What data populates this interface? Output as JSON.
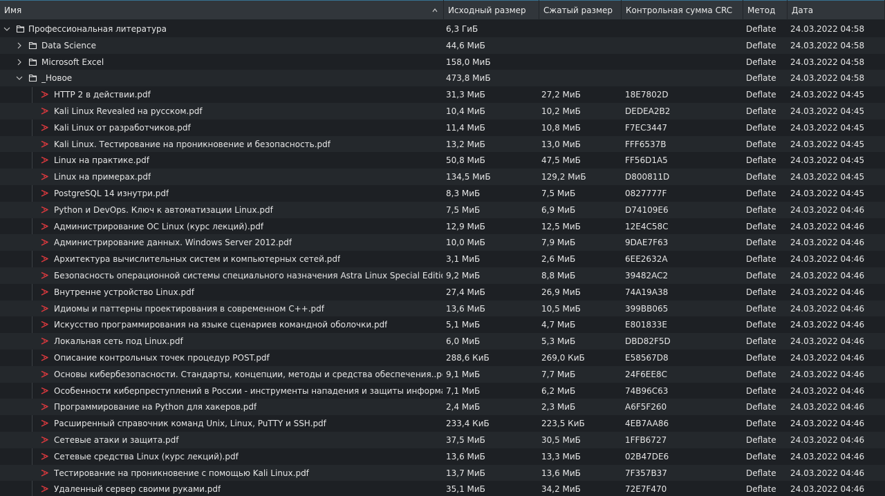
{
  "columns": [
    {
      "key": "name",
      "label": "Имя",
      "sorted": "ascending"
    },
    {
      "key": "orig",
      "label": "Исходный размер"
    },
    {
      "key": "comp",
      "label": "Сжатый размер"
    },
    {
      "key": "crc",
      "label": "Контрольная сумма CRC"
    },
    {
      "key": "method",
      "label": "Метод"
    },
    {
      "key": "date",
      "label": "Дата"
    }
  ],
  "rows": [
    {
      "type": "folder",
      "level": 0,
      "expanded": true,
      "name": "Профессиональная литература",
      "orig": "6,3 ГиБ",
      "comp": "",
      "crc": "",
      "method": "Deflate",
      "date": "24.03.2022 04:58"
    },
    {
      "type": "folder",
      "level": 1,
      "expanded": false,
      "name": "Data Science",
      "orig": "44,6 МиБ",
      "comp": "",
      "crc": "",
      "method": "Deflate",
      "date": "24.03.2022 04:58"
    },
    {
      "type": "folder",
      "level": 1,
      "expanded": false,
      "name": "Microsoft Excel",
      "orig": "158,0 МиБ",
      "comp": "",
      "crc": "",
      "method": "Deflate",
      "date": "24.03.2022 04:58"
    },
    {
      "type": "folder",
      "level": 1,
      "expanded": true,
      "name": "_Новое",
      "orig": "473,8 МиБ",
      "comp": "",
      "crc": "",
      "method": "Deflate",
      "date": "24.03.2022 04:58"
    },
    {
      "type": "pdf",
      "level": 2,
      "name": "HTTP 2 в действии.pdf",
      "orig": "31,3 МиБ",
      "comp": "27,2 МиБ",
      "crc": "18E7802D",
      "method": "Deflate",
      "date": "24.03.2022 04:45"
    },
    {
      "type": "pdf",
      "level": 2,
      "name": "Kali Linux Revealed на русском.pdf",
      "orig": "10,4 МиБ",
      "comp": "10,2 МиБ",
      "crc": "DEDEA2B2",
      "method": "Deflate",
      "date": "24.03.2022 04:45"
    },
    {
      "type": "pdf",
      "level": 2,
      "name": "Kali Linux от разработчиков.pdf",
      "orig": "11,4 МиБ",
      "comp": "10,8 МиБ",
      "crc": "F7EC3447",
      "method": "Deflate",
      "date": "24.03.2022 04:45"
    },
    {
      "type": "pdf",
      "level": 2,
      "name": "Kali Linux. Тестирование на проникновение и безопасность.pdf",
      "orig": "13,2 МиБ",
      "comp": "13,0 МиБ",
      "crc": "FFF6537B",
      "method": "Deflate",
      "date": "24.03.2022 04:45"
    },
    {
      "type": "pdf",
      "level": 2,
      "name": "Linux на практике.pdf",
      "orig": "50,8 МиБ",
      "comp": "47,5 МиБ",
      "crc": "FF56D1A5",
      "method": "Deflate",
      "date": "24.03.2022 04:45"
    },
    {
      "type": "pdf",
      "level": 2,
      "name": "Linux на примерах.pdf",
      "orig": "134,5 МиБ",
      "comp": "129,2 МиБ",
      "crc": "D800811D",
      "method": "Deflate",
      "date": "24.03.2022 04:45"
    },
    {
      "type": "pdf",
      "level": 2,
      "name": "PostgreSQL 14 изнутри.pdf",
      "orig": "8,3 МиБ",
      "comp": "7,5 МиБ",
      "crc": "0827777F",
      "method": "Deflate",
      "date": "24.03.2022 04:45"
    },
    {
      "type": "pdf",
      "level": 2,
      "name": "Python и DevOps. Ключ к автоматизации Linux.pdf",
      "orig": "7,5 МиБ",
      "comp": "6,9 МиБ",
      "crc": "D74109E6",
      "method": "Deflate",
      "date": "24.03.2022 04:46"
    },
    {
      "type": "pdf",
      "level": 2,
      "name": "Администрирование ОС Linux (курс лекций).pdf",
      "orig": "12,9 МиБ",
      "comp": "12,5 МиБ",
      "crc": "12E4C58C",
      "method": "Deflate",
      "date": "24.03.2022 04:46"
    },
    {
      "type": "pdf",
      "level": 2,
      "name": "Администрирование данных. Windows Server 2012.pdf",
      "orig": "10,0 МиБ",
      "comp": "7,9 МиБ",
      "crc": "9DAE7F63",
      "method": "Deflate",
      "date": "24.03.2022 04:46"
    },
    {
      "type": "pdf",
      "level": 2,
      "name": "Архитектура вычислительных систем и компьютерных сетей.pdf",
      "orig": "3,1 МиБ",
      "comp": "2,6 МиБ",
      "crc": "6EE2632A",
      "method": "Deflate",
      "date": "24.03.2022 04:46"
    },
    {
      "type": "pdf",
      "level": 2,
      "name": "Безопасность операционной системы специального назначения Astra Linux Special Edition.pdf",
      "orig": "9,2 МиБ",
      "comp": "8,8 МиБ",
      "crc": "39482AC2",
      "method": "Deflate",
      "date": "24.03.2022 04:46"
    },
    {
      "type": "pdf",
      "level": 2,
      "name": "Внутренне устройство Linux.pdf",
      "orig": "27,4 МиБ",
      "comp": "26,9 МиБ",
      "crc": "74A19A38",
      "method": "Deflate",
      "date": "24.03.2022 04:46"
    },
    {
      "type": "pdf",
      "level": 2,
      "name": "Идиомы и паттерны проектирования в современном С++.pdf",
      "orig": "13,6 МиБ",
      "comp": "10,5 МиБ",
      "crc": "399BB065",
      "method": "Deflate",
      "date": "24.03.2022 04:46"
    },
    {
      "type": "pdf",
      "level": 2,
      "name": "Искусство программирования на языке сценариев командной оболочки.pdf",
      "orig": "5,1 МиБ",
      "comp": "4,7 МиБ",
      "crc": "E801833E",
      "method": "Deflate",
      "date": "24.03.2022 04:46"
    },
    {
      "type": "pdf",
      "level": 2,
      "name": "Локальная сеть под Linux.pdf",
      "orig": "6,0 МиБ",
      "comp": "5,3 МиБ",
      "crc": "DBD82F5D",
      "method": "Deflate",
      "date": "24.03.2022 04:46"
    },
    {
      "type": "pdf",
      "level": 2,
      "name": "Описание контрольных точек процедур POST.pdf",
      "orig": "288,6 КиБ",
      "comp": "269,0 КиБ",
      "crc": "E58567D8",
      "method": "Deflate",
      "date": "24.03.2022 04:46"
    },
    {
      "type": "pdf",
      "level": 2,
      "name": "Основы кибербезопасности. Стандарты, концепции, методы и средства обеспечения..pdf",
      "orig": "9,1 МиБ",
      "comp": "7,7 МиБ",
      "crc": "24F6EE8C",
      "method": "Deflate",
      "date": "24.03.2022 04:46"
    },
    {
      "type": "pdf",
      "level": 2,
      "name": "Особенности киберпреступлений в России - инструменты нападения и защиты информации.pdf",
      "orig": "7,1 МиБ",
      "comp": "6,2 МиБ",
      "crc": "74B96C63",
      "method": "Deflate",
      "date": "24.03.2022 04:46"
    },
    {
      "type": "pdf",
      "level": 2,
      "name": "Программирование на Python для хакеров.pdf",
      "orig": "2,4 МиБ",
      "comp": "2,3 МиБ",
      "crc": "A6F5F260",
      "method": "Deflate",
      "date": "24.03.2022 04:46"
    },
    {
      "type": "pdf",
      "level": 2,
      "name": "Расширенный справочник команд Unix, Linux, PuTTY и SSH.pdf",
      "orig": "233,4 КиБ",
      "comp": "223,5 КиБ",
      "crc": "4EB7AA86",
      "method": "Deflate",
      "date": "24.03.2022 04:46"
    },
    {
      "type": "pdf",
      "level": 2,
      "name": "Сетевые атаки и защита.pdf",
      "orig": "37,5 МиБ",
      "comp": "30,5 МиБ",
      "crc": "1FFB6727",
      "method": "Deflate",
      "date": "24.03.2022 04:46"
    },
    {
      "type": "pdf",
      "level": 2,
      "name": "Сетевые средства Linux (курс лекций).pdf",
      "orig": "13,6 МиБ",
      "comp": "13,3 МиБ",
      "crc": "02B47DE6",
      "method": "Deflate",
      "date": "24.03.2022 04:46"
    },
    {
      "type": "pdf",
      "level": 2,
      "name": "Тестирование на проникновение с помощью Kali Linux.pdf",
      "orig": "13,7 МиБ",
      "comp": "13,6 МиБ",
      "crc": "7F357B37",
      "method": "Deflate",
      "date": "24.03.2022 04:46"
    },
    {
      "type": "pdf",
      "level": 2,
      "name": "Удаленный сервер своими руками.pdf",
      "orig": "35,1 МиБ",
      "comp": "34,2 МиБ",
      "crc": "72E7F470",
      "method": "Deflate",
      "date": "24.03.2022 04:46"
    }
  ],
  "colors": {
    "header_bg": "#31363b",
    "row_bg": "#1d2024",
    "row_alt_bg": "#24282c",
    "text": "#e6e6e6",
    "pdf_icon": "#e0393e",
    "accent": "#3daee9"
  },
  "icons": {
    "folder": "folder-icon",
    "pdf": "pdf-file-icon",
    "expanded": "chevron-down-icon",
    "collapsed": "chevron-right-icon",
    "sort": "sort-ascending-icon"
  }
}
